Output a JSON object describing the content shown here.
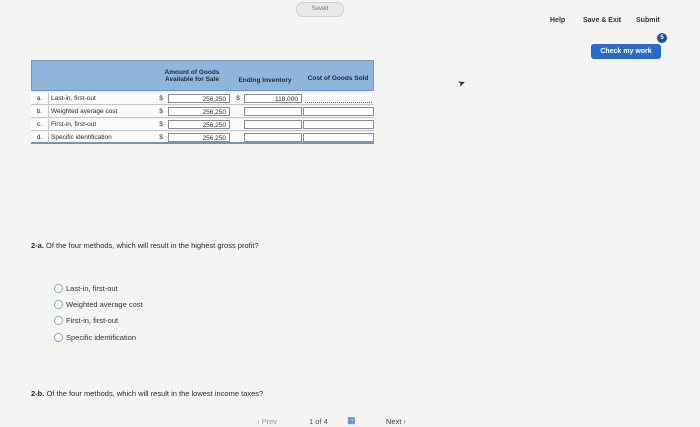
{
  "header": {
    "saved_label": "Saved",
    "help_label": "Help",
    "save_exit_label": "Save & Exit",
    "submit_label": "Submit",
    "check_work_label": "Check my work",
    "check_work_badge": "5"
  },
  "table": {
    "headers": {
      "amount_available": "Amount of Goods Available for Sale",
      "ending_inventory": "Ending Inventory",
      "cost_of_goods": "Cost of Goods Sold"
    },
    "rows": [
      {
        "letter": "a.",
        "method": "Last-in, first-out",
        "dollar": "$",
        "amount": "256,250",
        "dollar2": "$",
        "ending": "118,000"
      },
      {
        "letter": "b.",
        "method": "Weighted average cost",
        "dollar": "$",
        "amount": "256,250",
        "dollar2": "",
        "ending": ""
      },
      {
        "letter": "c.",
        "method": "First-in, first-out",
        "dollar": "$",
        "amount": "256,250",
        "dollar2": "",
        "ending": ""
      },
      {
        "letter": "d.",
        "method": "Specific identification",
        "dollar": "$",
        "amount": "256,250",
        "dollar2": "",
        "ending": ""
      }
    ]
  },
  "q2a": {
    "label": "2-a.",
    "text": "Of the four methods, which will result in the highest gross profit?",
    "options": [
      "Last-in, first-out",
      "Weighted average cost",
      "First-in, first-out",
      "Specific identification"
    ]
  },
  "q2b": {
    "label": "2-b.",
    "text": "Of the four methods, which will result in the lowest income taxes?"
  },
  "footer": {
    "prev_label": "Prev",
    "page_current": "1",
    "page_of": "of",
    "page_total": "4",
    "next_label": "Next"
  },
  "icons": {
    "cursor": "mouse-pointer-icon",
    "grid": "grid-icon",
    "next": "chevron-right-icon",
    "prev": "chevron-left-icon"
  }
}
